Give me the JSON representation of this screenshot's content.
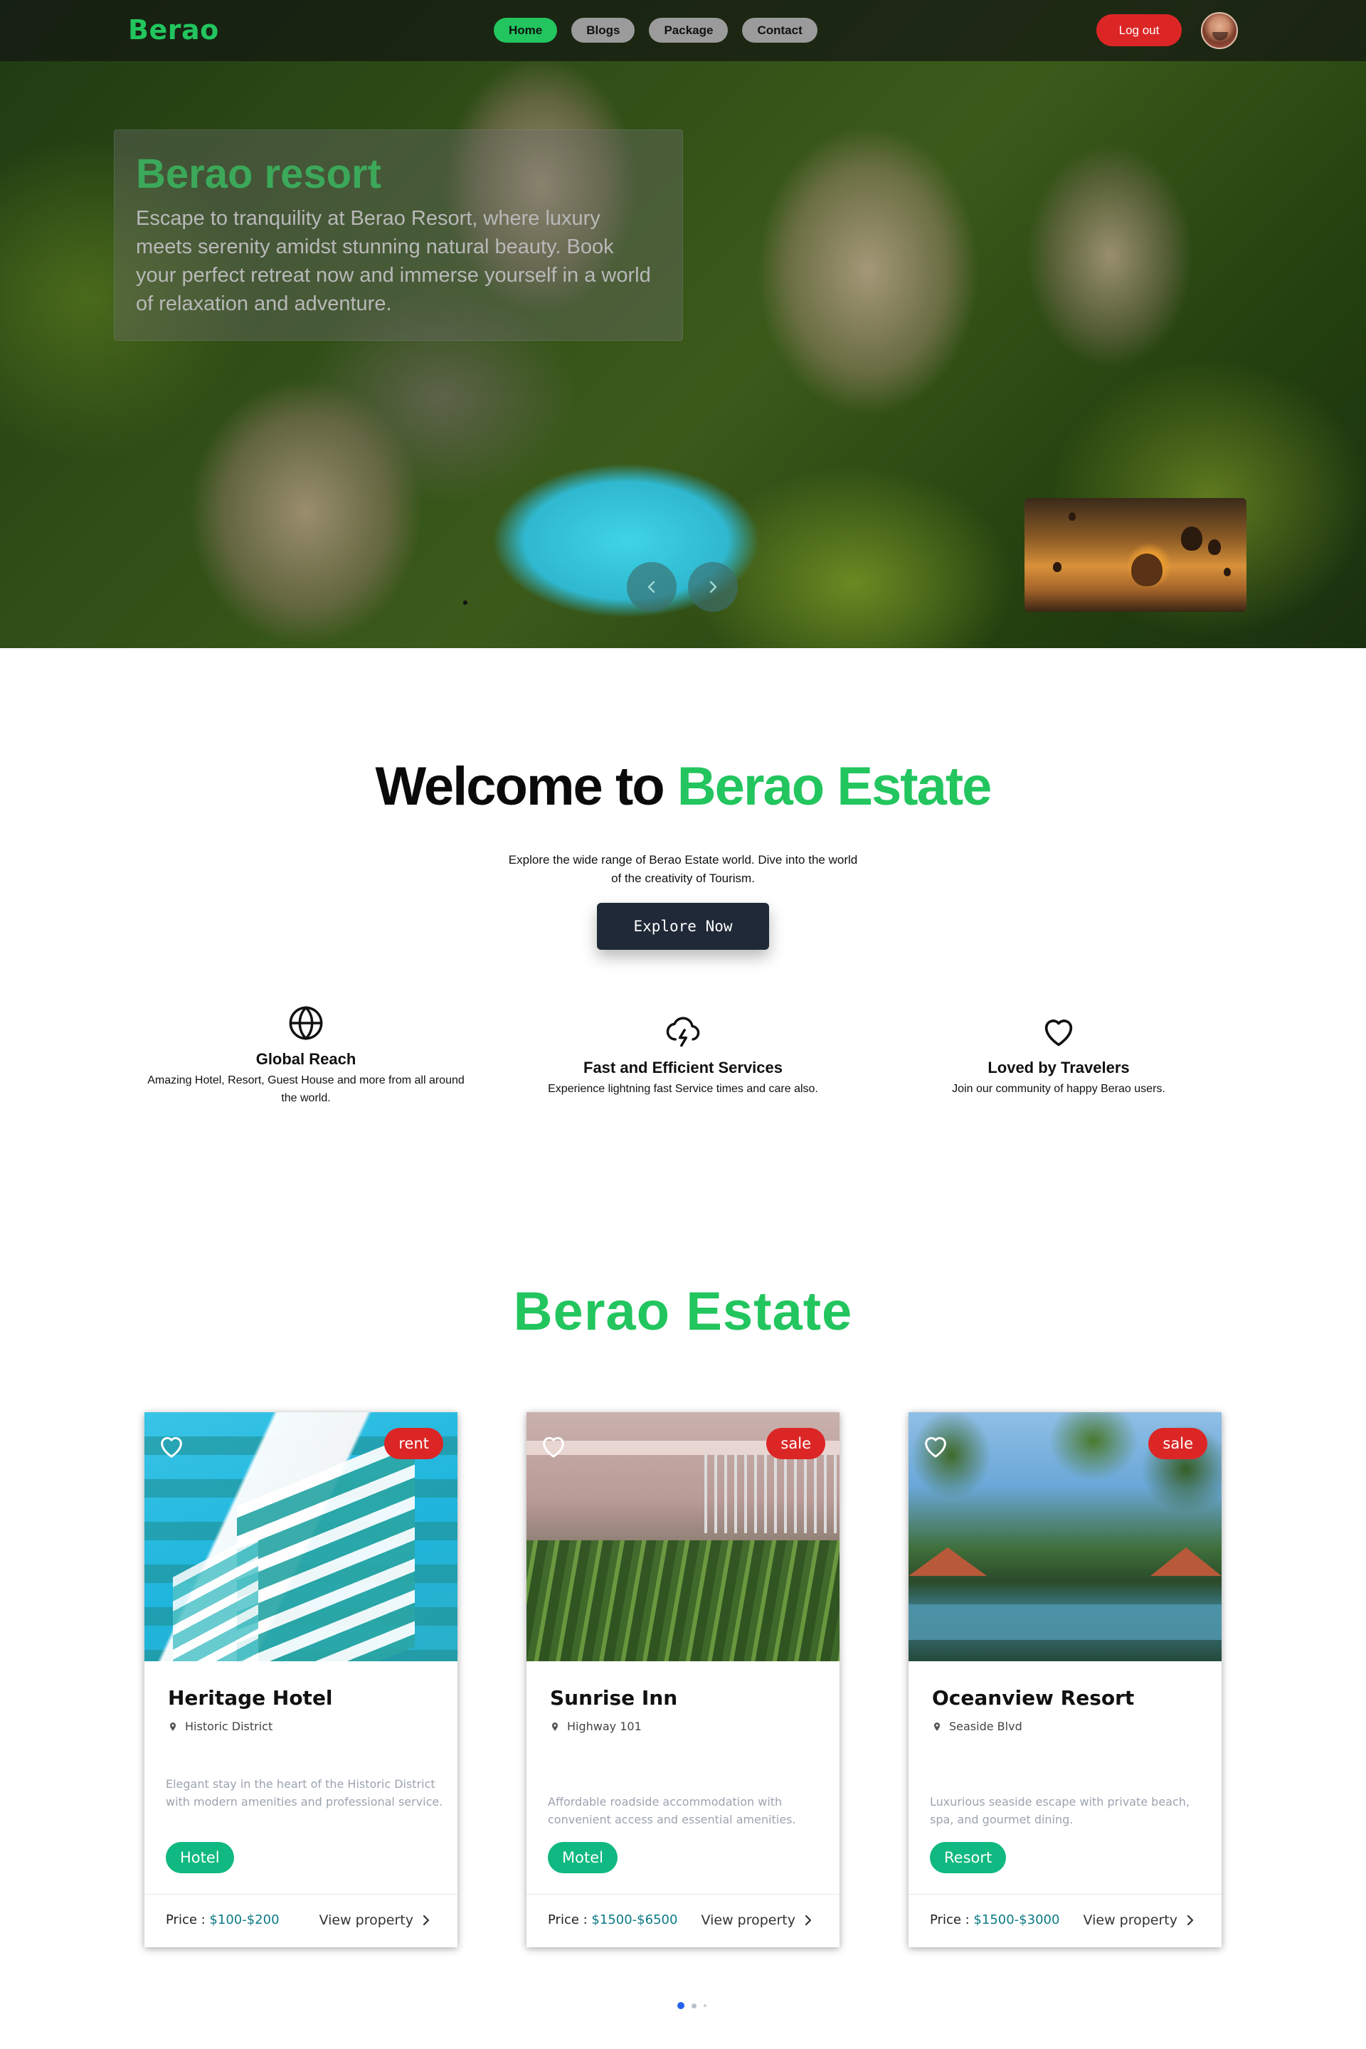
{
  "nav": {
    "logo": "Berao",
    "links": [
      "Home",
      "Blogs",
      "Package",
      "Contact"
    ],
    "active": "Home",
    "logout": "Log out"
  },
  "hero": {
    "title": "Berao resort",
    "description": "Escape to tranquility at Berao Resort, where luxury meets serenity amidst stunning natural beauty. Book your perfect retreat now and immerse yourself in a world of relaxation and adventure."
  },
  "welcome": {
    "title_prefix": "Welcome to",
    "title_accent": "Berao Estate",
    "description": "Explore the wide range of Berao Estate world. Dive into the world of the creativity of Tourism.",
    "button": "Explore Now"
  },
  "features": [
    {
      "icon": "globe-icon",
      "title": "Global Reach",
      "description": "Amazing Hotel, Resort, Guest House and more from all around the world."
    },
    {
      "icon": "cloud-lightning-icon",
      "title": "Fast and Efficient Services",
      "description": "Experience lightning fast Service times and care also."
    },
    {
      "icon": "heart-icon",
      "title": "Loved by Travelers",
      "description": "Join our community of happy Berao users."
    }
  ],
  "estate": {
    "title": "Berao Estate",
    "price_label": "Price : ",
    "view_label": "View property",
    "cards": [
      {
        "badge": "rent",
        "name": "Heritage Hotel",
        "location": "Historic District",
        "description": "Elegant stay in the heart of the Historic District with modern amenities and professional service.",
        "tag": "Hotel",
        "price": "$100-$200"
      },
      {
        "badge": "sale",
        "name": "Sunrise Inn",
        "location": "Highway 101",
        "description": "Affordable roadside accommodation with convenient access and essential amenities.",
        "tag": "Motel",
        "price": "$1500-$6500"
      },
      {
        "badge": "sale",
        "name": "Oceanview Resort",
        "location": "Seaside Blvd",
        "description": "Luxurious seaside escape with private beach, spa, and gourmet dining.",
        "tag": "Resort",
        "price": "$1500-$3000"
      }
    ]
  },
  "colors": {
    "accent": "#22c55e",
    "danger": "#dc2626",
    "tag": "#10b981",
    "price": "#0d7a86"
  }
}
